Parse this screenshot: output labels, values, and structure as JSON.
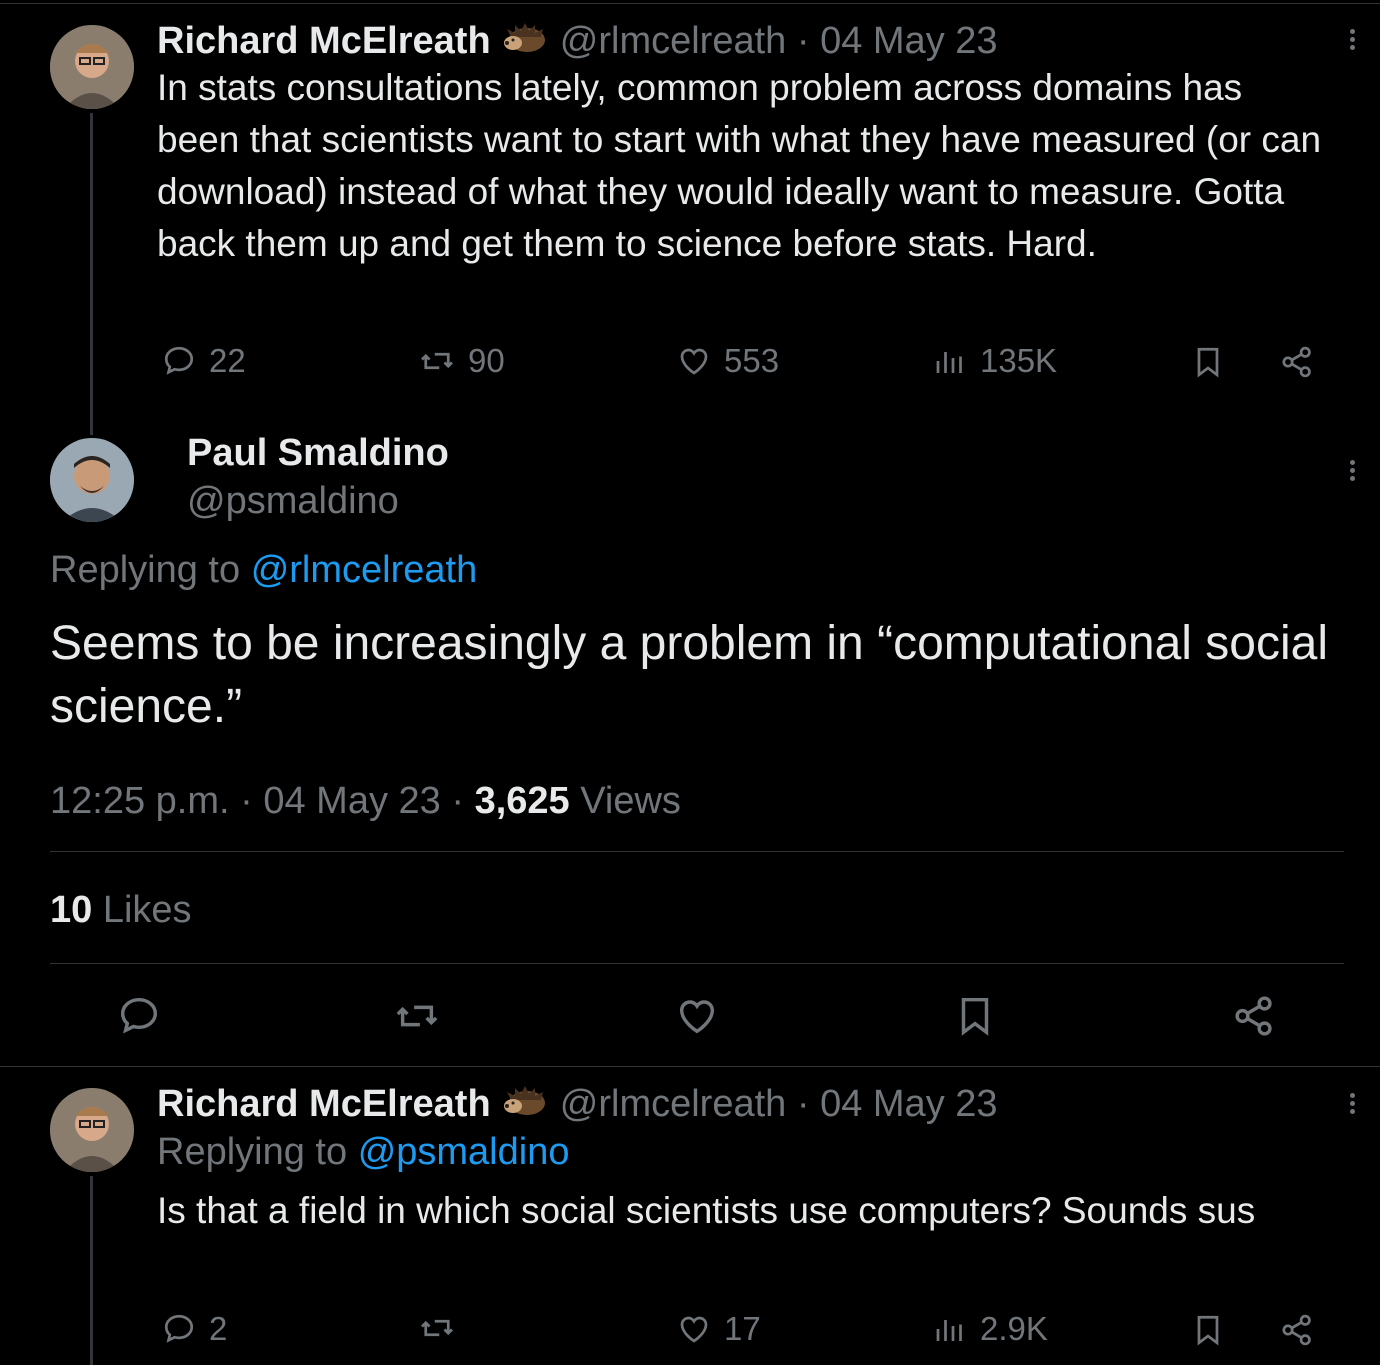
{
  "tweet1": {
    "name": "Richard McElreath",
    "handle": "@rlmcelreath",
    "sep": "·",
    "date": "04 May 23",
    "text": "In stats consultations lately, common problem across domains has been that scientists want to start with what they have measured (or can download) instead of what they would ideally want to measure. Gotta back them up and get them to science before stats. Hard.",
    "replies": "22",
    "retweets": "90",
    "likes": "553",
    "views": "135K"
  },
  "main": {
    "name": "Paul Smaldino",
    "handle": "@psmaldino",
    "replying_prefix": "Replying to",
    "replying_handle": "@rlmcelreath",
    "text": "Seems to be increasingly a problem in “computational social science.”",
    "time": "12:25 p.m.",
    "date": "04 May 23",
    "views_count": "3,625",
    "views_label": "Views",
    "likes_count": "10",
    "likes_label": "Likes"
  },
  "tweet2": {
    "name": "Richard McElreath",
    "handle": "@rlmcelreath",
    "date": "04 May 23",
    "replying_prefix": "Replying to",
    "replying_handle": "@psmaldino",
    "text": "Is that a field in which social scientists use computers? Sounds sus",
    "replies": "2",
    "likes": "17",
    "views": "2.9K"
  },
  "icons": {
    "reply": "speech-bubble-icon",
    "retweet": "retweet-arrows-icon",
    "like": "heart-icon",
    "views": "bar-chart-icon",
    "bookmark": "bookmark-icon",
    "share": "share-nodes-icon",
    "more": "vertical-ellipsis-icon",
    "badge": "hedgehog-emoji-icon"
  },
  "colors": {
    "background": "#000000",
    "text": "#e7e9ea",
    "muted": "#71767b",
    "link": "#1d9bf0"
  }
}
